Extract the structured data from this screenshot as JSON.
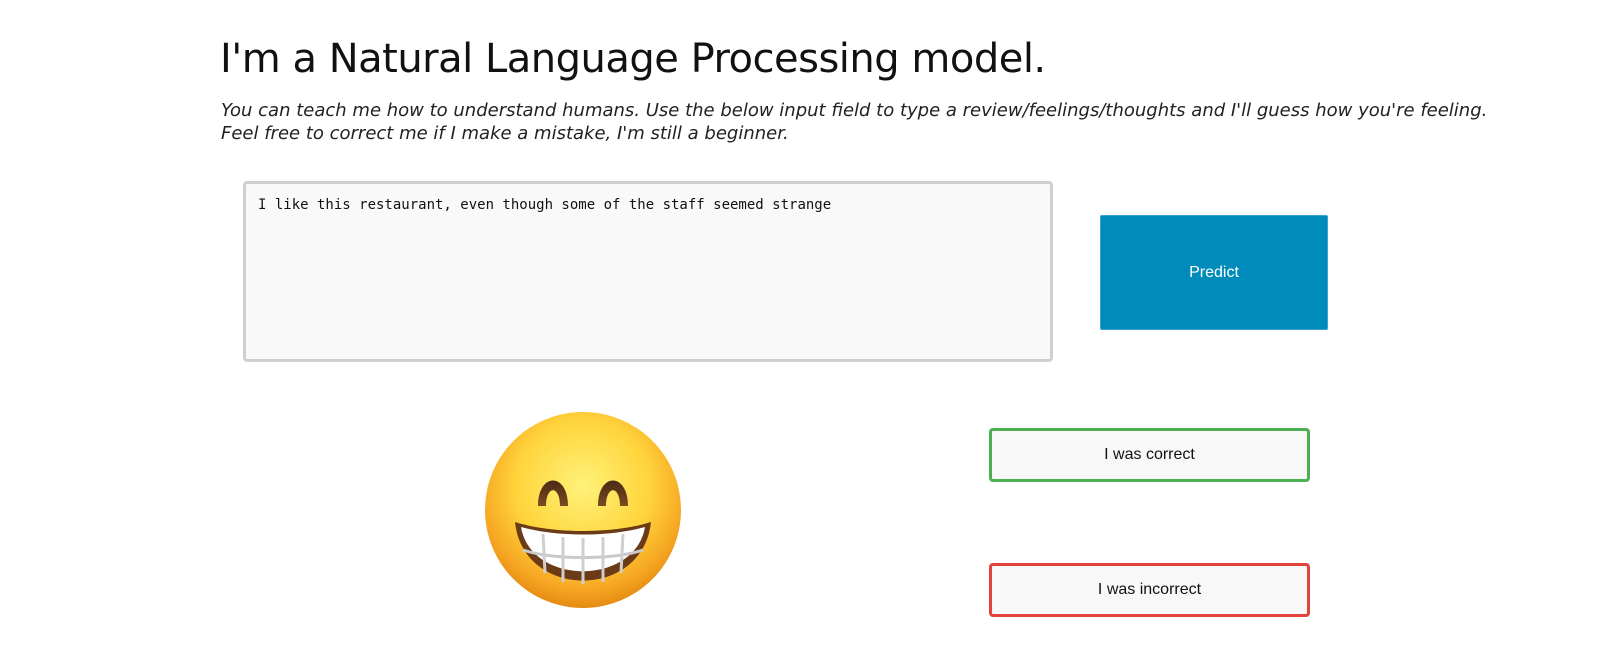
{
  "header": {
    "title": "I'm a Natural Language Processing model.",
    "intro_line1": "You can teach me how to understand humans. Use the below input field to type a review/feelings/thoughts and I'll guess how you're feeling.",
    "intro_line2": "Feel free to correct me if I make a mistake, I'm still a beginner."
  },
  "input": {
    "value": "I like this restaurant, even though some of the staff seemed strange"
  },
  "buttons": {
    "predict_label": "Predict",
    "correct_label": "I was correct",
    "incorrect_label": "I was incorrect"
  },
  "prediction": {
    "emoji_icon": "grinning-face-with-smiling-eyes-icon"
  },
  "colors": {
    "predict_bg": "#008cba",
    "correct_border": "#4caf50",
    "incorrect_border": "#e2433a"
  }
}
